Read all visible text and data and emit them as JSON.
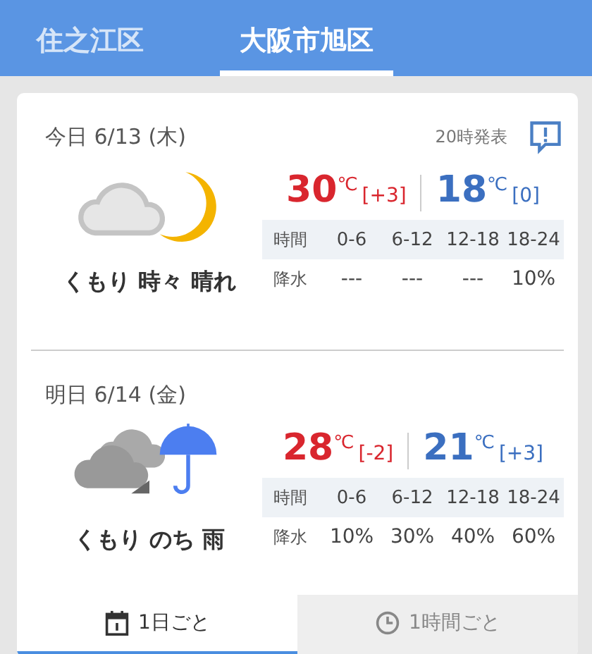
{
  "area_tabs": [
    {
      "label": "住之江区",
      "selected": false
    },
    {
      "label": "大阪市旭区",
      "selected": true
    }
  ],
  "days": [
    {
      "date": "今日 6/13 (木)",
      "issued": "20時発表",
      "kind": "cloudy-moon",
      "condition": "くもり 時々 晴れ",
      "high": "30",
      "high_unit": "℃",
      "high_diff": "[+3]",
      "low": "18",
      "low_unit": "℃",
      "low_diff": "[0]",
      "header_label": "時間",
      "periods": [
        "0-6",
        "6-12",
        "12-18",
        "18-24"
      ],
      "precip_label": "降水",
      "precip": [
        "---",
        "---",
        "---",
        "10%"
      ]
    },
    {
      "date": "明日 6/14 (金)",
      "kind": "cloudy-then-rain",
      "condition": "くもり のち 雨",
      "high": "28",
      "high_unit": "℃",
      "high_diff": "[-2]",
      "low": "21",
      "low_unit": "℃",
      "low_diff": "[+3]",
      "header_label": "時間",
      "periods": [
        "0-6",
        "6-12",
        "12-18",
        "18-24"
      ],
      "precip_label": "降水",
      "precip": [
        "10%",
        "30%",
        "40%",
        "60%"
      ]
    }
  ],
  "view_tabs": [
    {
      "label": "1日ごと",
      "kind": "calendar",
      "selected": true
    },
    {
      "label": "1時間ごと",
      "kind": "clock",
      "selected": false
    }
  ]
}
